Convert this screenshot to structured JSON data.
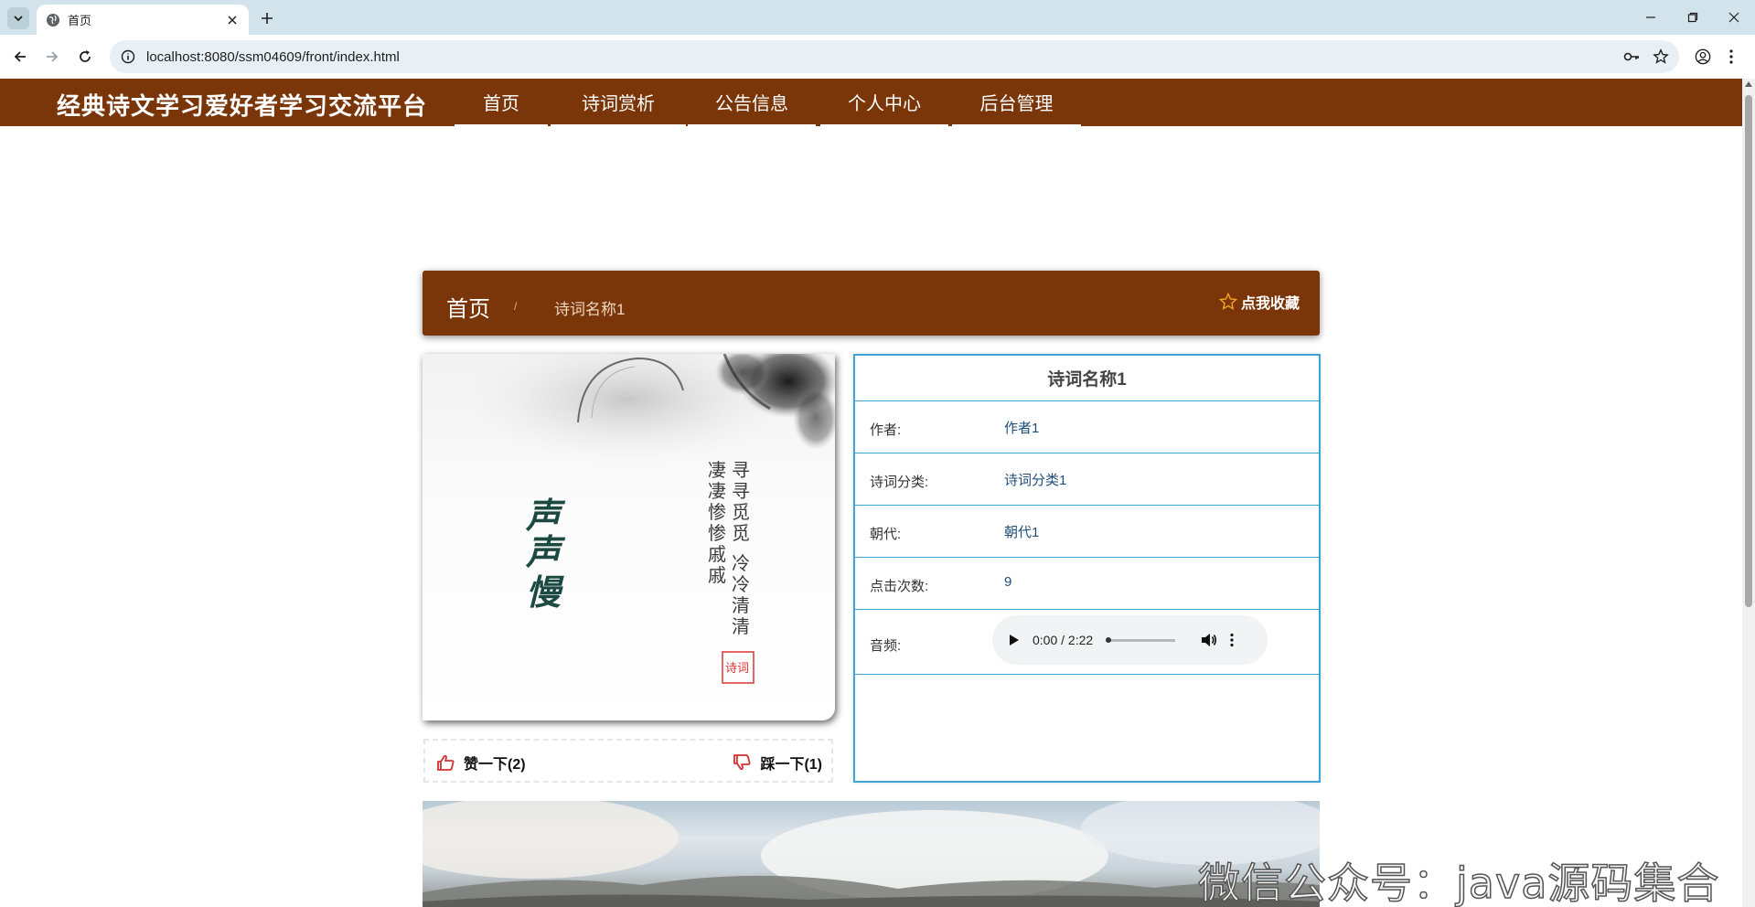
{
  "browser": {
    "tab_title": "首页",
    "url": "localhost:8080/ssm04609/front/index.html"
  },
  "site": {
    "title": "经典诗文学习爱好者学习交流平台",
    "nav": [
      "首页",
      "诗词赏析",
      "公告信息",
      "个人中心",
      "后台管理"
    ]
  },
  "breadcrumb": {
    "home": "首页",
    "separator": "/",
    "current": "诗词名称1",
    "favorite_label": "点我收藏"
  },
  "poem_image": {
    "title_text": "声声慢",
    "verse_text": "寻寻觅觅 冷冷清清 凄凄惨惨戚戚",
    "seal_text": "诗词"
  },
  "votes": {
    "like_label": "赞一下(2)",
    "dislike_label": "踩一下(1)"
  },
  "info": {
    "title": "诗词名称1",
    "rows": [
      {
        "label": "作者:",
        "value": "作者1"
      },
      {
        "label": "诗词分类:",
        "value": "诗词分类1"
      },
      {
        "label": "朝代:",
        "value": "朝代1"
      },
      {
        "label": "点击次数:",
        "value": "9"
      }
    ],
    "audio_label": "音频:",
    "audio_time": "0:00 / 2:22"
  },
  "watermark": "微信公众号：java源码集合",
  "colors": {
    "brand": "#7a3509",
    "table_border": "#3aa5d6",
    "value_text": "#1e4d7a"
  }
}
